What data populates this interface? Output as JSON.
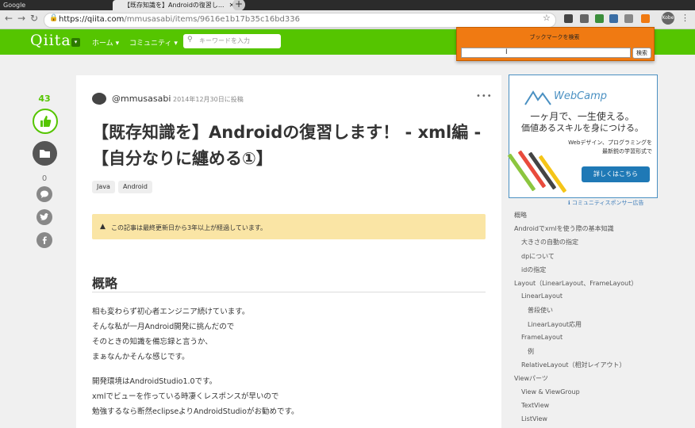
{
  "browser": {
    "tabs": [
      {
        "label": "Google",
        "active": false
      },
      {
        "label": "【既存知識を】Androidの復習し...",
        "active": true
      }
    ],
    "new_tab": "+",
    "url_host": "https://qiita.com",
    "url_path": "/mmusasabi/items/9616e1b17b35c16bd336",
    "profile": "Kobe"
  },
  "header": {
    "logo": "Qiita",
    "nav": [
      "ホーム",
      "コミュニティ"
    ],
    "search_placeholder": "キーワードを入力"
  },
  "bookmark_popup": {
    "title": "ブックマークを検索",
    "button": "検索"
  },
  "actions": {
    "like_count": "43",
    "stock_count": "0"
  },
  "article": {
    "username": "@mmusasabi",
    "post_date": "2014年12月30日に投稿",
    "more": "•••",
    "title": "【既存知識を】Androidの復習します！ - xml編 -【自分なりに纏める①】",
    "tags": [
      "Java",
      "Android"
    ],
    "alert": "この記事は最終更新日から3年以上が経過しています。",
    "heading": "概略",
    "para1": [
      "相も変わらず初心者エンジニア続けています。",
      "そんな私が一月Android開発に挑んだので",
      "そのときの知識を備忘録と言うか、",
      "まぁなんかそんな感じです。"
    ],
    "para2": [
      "開発環境はAndroidStudio1.0です。",
      "xmlでビューを作っている時凄くレスポンスが早いので",
      "勉強するなら断然eclipseよりAndroidStudioがお勧めです。"
    ]
  },
  "ad": {
    "brand": "WebCamp",
    "line1": "一ヶ月で、一生使える。",
    "line2": "価値あるスキルを身につける。",
    "line3": "Webデザイン、プログラミングを",
    "line4": "最新鋭の学習形式で",
    "button": "詳しくはこちら",
    "sponsor": "コミュニティスポンサー広告"
  },
  "toc": [
    {
      "label": "概略",
      "level": 0
    },
    {
      "label": "Androidでxmlを使う際の基本知識",
      "level": 0
    },
    {
      "label": "大きさの自動の指定",
      "level": 1
    },
    {
      "label": "dpについて",
      "level": 1
    },
    {
      "label": "idの指定",
      "level": 1
    },
    {
      "label": "Layout（LinearLayout、FrameLayout）",
      "level": 0
    },
    {
      "label": "LinearLayout",
      "level": 1
    },
    {
      "label": "普段使い",
      "level": 2
    },
    {
      "label": "LinearLayout応用",
      "level": 2
    },
    {
      "label": "FrameLayout",
      "level": 1
    },
    {
      "label": "例",
      "level": 2
    },
    {
      "label": "RelativeLayout（相対レイアウト）",
      "level": 1
    },
    {
      "label": "Viewパーツ",
      "level": 0
    },
    {
      "label": "View & ViewGroup",
      "level": 1
    },
    {
      "label": "TextView",
      "level": 1
    },
    {
      "label": "ListView",
      "level": 1
    }
  ],
  "colors": {
    "qiita_green": "#55c500",
    "bookmark_orange": "#f07a12",
    "ad_blue": "#1f79b6"
  }
}
